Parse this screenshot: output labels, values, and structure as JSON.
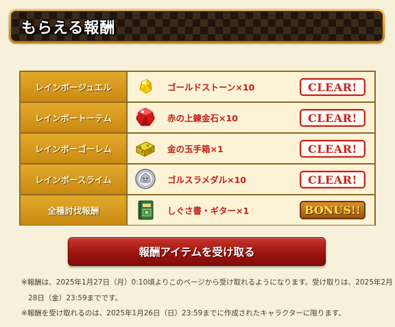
{
  "header": {
    "title": "もらえる報酬"
  },
  "rewards": [
    {
      "condition": "レインボージュエル",
      "item": "ゴールドストーン×10",
      "icon": "gold-stone-icon",
      "badge": "CLEAR!"
    },
    {
      "condition": "レインボートーテム",
      "item": "赤の上錬金石×10",
      "icon": "red-alchemy-stone-icon",
      "badge": "CLEAR!"
    },
    {
      "condition": "レインボーゴーレム",
      "item": "金の玉手箱×1",
      "icon": "gold-treasure-box-icon",
      "badge": "CLEAR!"
    },
    {
      "condition": "レインボースライム",
      "item": "ゴルスラメダル×10",
      "icon": "golslime-medal-icon",
      "badge": "CLEAR!"
    },
    {
      "condition": "全種討伐報酬",
      "item": "しぐさ書・ギター×1",
      "icon": "gesture-book-icon",
      "badge": "BONUS!!"
    }
  ],
  "receive_button": {
    "label": "報酬アイテムを受け取る"
  },
  "notes": {
    "line1a": "※報酬は、2025年1月27日（月）0:10頃よりこのページから受け取れるようになります。受け取りは、2025年2月",
    "line1b": "28日（金）23:59までです。",
    "line2": "※報酬を受け取れるのは、2025年1月26日（日）23:59までに作成されたキャラクターに限ります。"
  },
  "colors": {
    "accent_red": "#c8241e",
    "gold": "#e3a92a",
    "background": "#f7f1dc",
    "button_red": "#9d1410"
  }
}
